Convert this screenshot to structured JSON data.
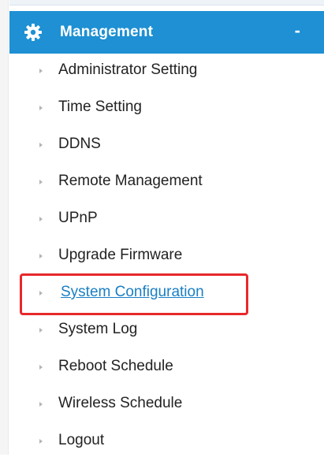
{
  "menu": {
    "header": {
      "title": "Management",
      "toggle": "-",
      "icon": "gear-icon",
      "background_color": "#1e90d3"
    },
    "items": [
      {
        "label": "Administrator Setting",
        "name": "administrator-setting"
      },
      {
        "label": "Time Setting",
        "name": "time-setting"
      },
      {
        "label": "DDNS",
        "name": "ddns"
      },
      {
        "label": "Remote Management",
        "name": "remote-management"
      },
      {
        "label": "UPnP",
        "name": "upnp"
      },
      {
        "label": "Upgrade Firmware",
        "name": "upgrade-firmware"
      },
      {
        "label": "System Configuration",
        "name": "system-configuration",
        "active": true
      },
      {
        "label": "System Log",
        "name": "system-log"
      },
      {
        "label": "Reboot Schedule",
        "name": "reboot-schedule"
      },
      {
        "label": "Wireless Schedule",
        "name": "wireless-schedule"
      },
      {
        "label": "Logout",
        "name": "logout"
      }
    ],
    "active_item_color": "#1a7fc4",
    "highlight_color": "#e8282b"
  }
}
